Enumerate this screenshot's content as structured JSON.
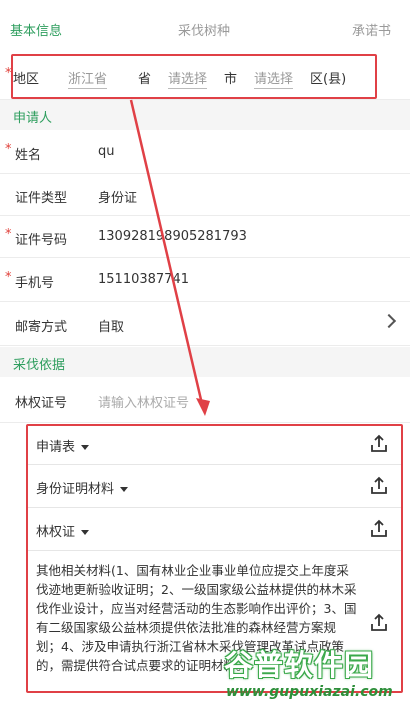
{
  "tabs": [
    {
      "label": "基本信息",
      "active": true
    },
    {
      "label": "采伐树种",
      "active": false
    },
    {
      "label": "承诺书",
      "active": false
    }
  ],
  "region": {
    "required_mark": "*",
    "label": "地区",
    "province_value": "浙江省",
    "province_unit": "省",
    "city_placeholder": "请选择",
    "city_unit": "市",
    "district_placeholder": "请选择",
    "district_unit": "区(县)"
  },
  "applicant_section": "申请人",
  "fields": {
    "name": {
      "required_mark": "*",
      "label": "姓名",
      "value": "qu"
    },
    "id_type": {
      "label": "证件类型",
      "value": "身份证"
    },
    "id_number": {
      "required_mark": "*",
      "label": "证件号码",
      "value": "130928198905281793"
    },
    "phone": {
      "required_mark": "*",
      "label": "手机号",
      "value": "15110387741"
    },
    "mail": {
      "label": "邮寄方式",
      "value": "自取"
    }
  },
  "basis_section": "采伐依据",
  "forest_cert": {
    "label": "林权证号",
    "placeholder": "请输入林权证号"
  },
  "uploads": [
    {
      "label": "申请表"
    },
    {
      "label": "身份证明材料"
    },
    {
      "label": "林权证"
    }
  ],
  "other_materials": "其他相关材料(1、国有林业企业事业单位应提交上年度采伐迹地更新验收证明；2、一级国家级公益林提供的林木采伐作业设计，应当对经营活动的生态影响作出评价；3、国有二级国家级公益林须提供依法批准的森林经营方案规划；4、涉及申请执行浙江省林木采伐管理改革试点政策的，需提供符合试点要求的证明材料。)",
  "watermark": {
    "title": "谷普软件园",
    "url": "www.gupuxiazai.com"
  },
  "colors": {
    "accent": "#2e9e5e",
    "annotation": "#e04046",
    "required": "#e0403a"
  }
}
